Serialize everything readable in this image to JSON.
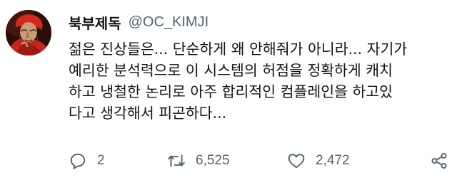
{
  "author": {
    "display_name": "북부제독",
    "handle": "@OC_KIMJI"
  },
  "tweet": {
    "lines": [
      "젊은 진상들은... 단순하게 왜 안해줘가 아니라... 자기가",
      "예리한 분석력으로 이 시스템의 허점을 정확하게 캐치",
      "하고 냉철한 논리로 아주 합리적인 컴플레인을 하고있",
      "다고 생각해서 피곤하다..."
    ]
  },
  "actions": {
    "reply": {
      "icon": "reply-icon",
      "count": "2"
    },
    "retweet": {
      "icon": "retweet-icon",
      "count": "6,525"
    },
    "like": {
      "icon": "heart-icon",
      "count": "2,472"
    },
    "share": {
      "icon": "share-icon"
    }
  },
  "colors": {
    "text": "#0f1419",
    "secondary": "#536471",
    "background": "#ffffff"
  }
}
